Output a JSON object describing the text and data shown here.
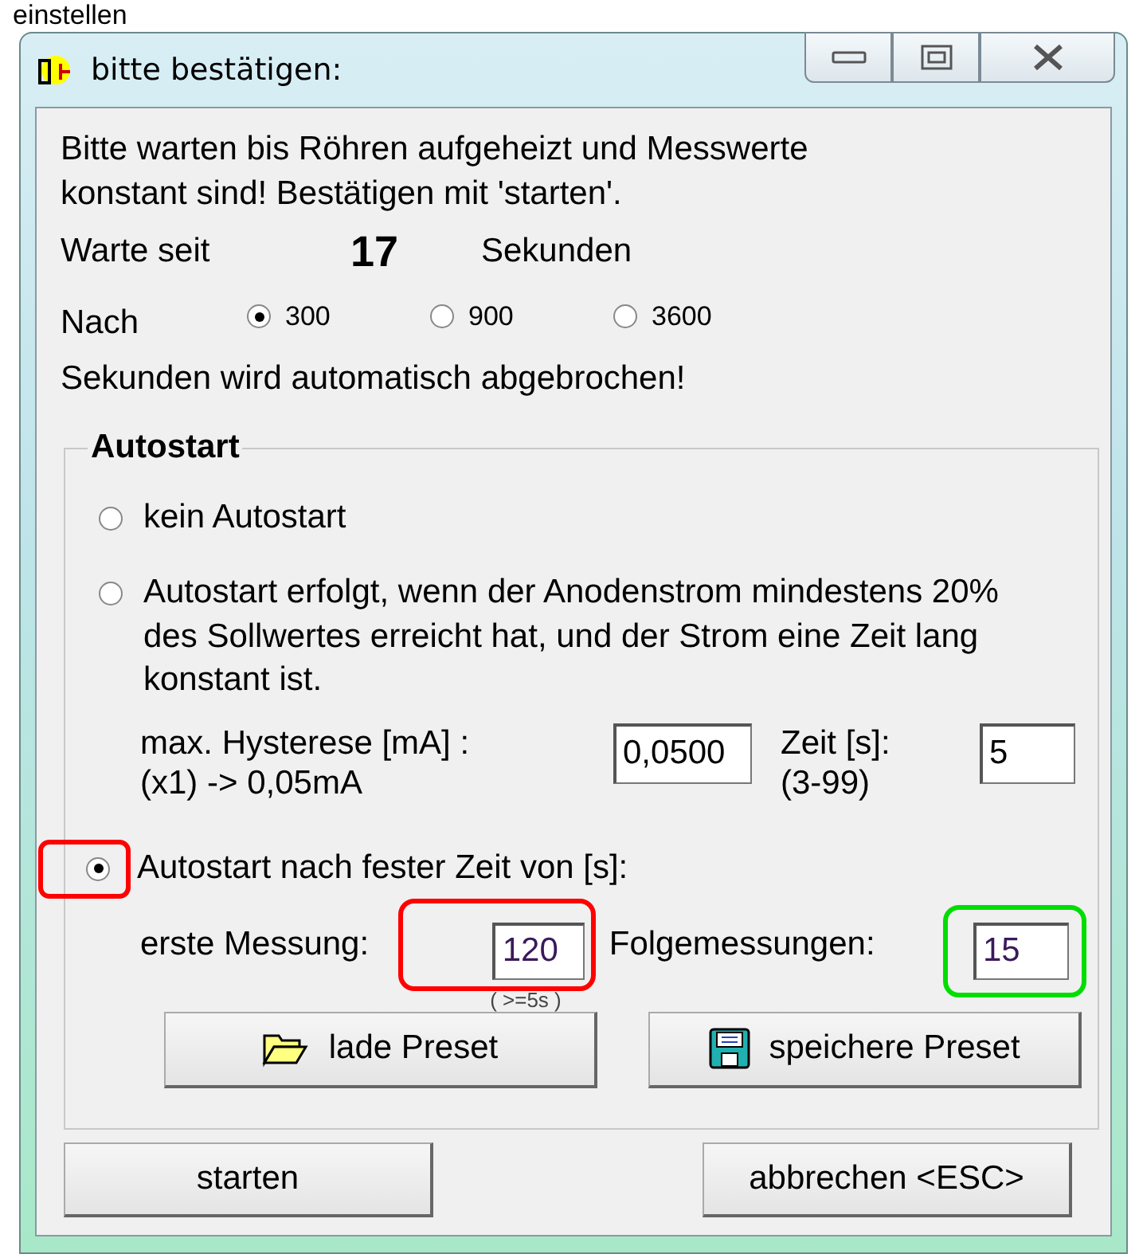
{
  "page_heading": "einstellen",
  "window": {
    "title": "bitte bestätigen:"
  },
  "message_lines": [
    "Bitte warten bis Röhren aufgeheizt und Messwerte",
    "konstant sind! Bestätigen mit 'starten'."
  ],
  "wait": {
    "label": "Warte seit",
    "count": "17",
    "unit": "Sekunden"
  },
  "timeout": {
    "label": "Nach",
    "options": [
      {
        "label": "300",
        "selected": true
      },
      {
        "label": "900",
        "selected": false
      },
      {
        "label": "3600",
        "selected": false
      }
    ],
    "note": "Sekunden wird automatisch abgebrochen!"
  },
  "autostart": {
    "title": "Autostart",
    "options": [
      {
        "kind": "plain",
        "selected": false,
        "label_lines": [
          "kein Autostart"
        ]
      },
      {
        "kind": "hysteresis",
        "selected": false,
        "label_lines": [
          "Autostart erfolgt, wenn der Anodenstrom mindestens 20%",
          "des Sollwertes erreicht hat, und der Strom eine Zeit lang",
          "konstant ist."
        ],
        "hysteresis_label": "max. Hysterese [mA] :",
        "hysteresis_hint": "(x1) -> 0,05mA",
        "hysteresis_value": "0,0500",
        "time_label": "Zeit [s]:",
        "time_hint": "(3-99)",
        "time_value": "5"
      },
      {
        "kind": "fixed",
        "selected": true,
        "highlight": {
          "color": "#ff0000"
        },
        "label_lines": [
          "Autostart nach fester Zeit von  [s]:"
        ],
        "first_label": "erste Messung:",
        "first_value": "120",
        "first_hint": "( >=5s )",
        "first_highlight": {
          "color": "#ff0000"
        },
        "next_label": "Folgemessungen:",
        "next_value": "15",
        "next_highlight": {
          "color": "#00dd00"
        }
      }
    ],
    "load_button": "lade Preset",
    "save_button": "speichere Preset"
  },
  "buttons": [
    "starten",
    "abbrechen <ESC>"
  ]
}
